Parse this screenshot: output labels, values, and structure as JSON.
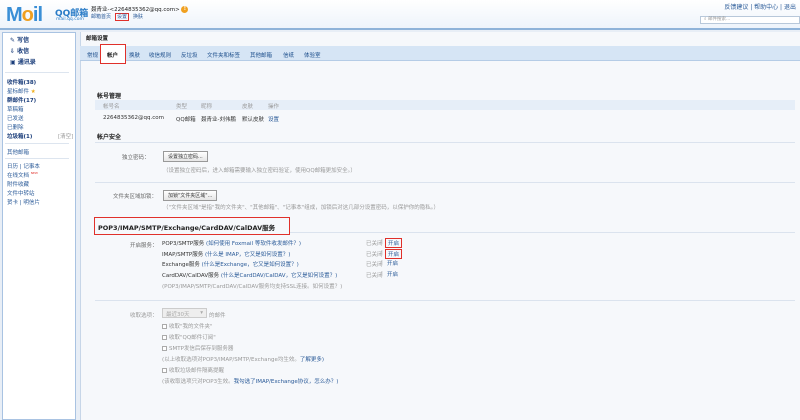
{
  "header": {
    "logo_text": "Mail",
    "brand": "QQ邮箱",
    "domain": "mail.qq.com",
    "user": "聂青业-<2264835362@qq.com>",
    "links": [
      "邮箱首页",
      "设置",
      "换肤"
    ],
    "right_links": "反馈建议 | 帮助中心 | 退出",
    "search_placeholder": "邮件搜索..."
  },
  "sidebar": {
    "write": "写信",
    "inbox": "收信",
    "contacts": "通讯录",
    "folders": [
      "收件箱(38)",
      "星标邮件",
      "群邮件(17)",
      "草稿箱",
      "已发送",
      "已删除",
      "垃圾箱(1)"
    ],
    "clear": "[清空]",
    "other": "其他邮箱",
    "tools": [
      "日历 | 记事本",
      "在线文档",
      "附件收藏",
      "文件中转站",
      "贺卡 | 明信片"
    ],
    "new_badge": "NEW"
  },
  "main": {
    "title": "邮箱设置",
    "tabs": [
      "常规",
      "帐户",
      "换肤",
      "收信规则",
      "反垃圾",
      "文件夹和标签",
      "其他邮箱",
      "信纸",
      "体验室"
    ],
    "acct_mgmt": {
      "title": "帐号管理",
      "headers": [
        "帐号名",
        "类型",
        "昵称",
        "皮肤",
        "操作"
      ],
      "row": [
        "2264835362@qq.com",
        "QQ邮箱",
        "聂青业-刘伟鹏",
        "默认皮肤",
        "设置"
      ]
    },
    "security": {
      "title": "帐户安全",
      "pwd_label": "独立密码：",
      "pwd_btn": "设置独立密码...",
      "pwd_desc": "（设置独立密码后，进入邮箱需要输入独立密码验证，使用QQ邮箱更加安全。）",
      "lock_label": "文件夹区域加锁：",
      "lock_btn": "加锁\"文件夹区域\"...",
      "lock_desc": "（\"文件夹区域\"是指\"我的文件夹\"、\"其他邮箱\"、\"记事本\"组成，加锁后对这几部分设置密码，以保护你的隐私。）"
    },
    "pop": {
      "title": "POP3/IMAP/SMTP/Exchange/CardDAV/CalDAV服务",
      "label": "开启服务：",
      "services": [
        {
          "name": "POP3/SMTP服务",
          "help": "(如何使用 Foxmail 等软件收发邮件？)",
          "status": "已关闭",
          "action": "开启"
        },
        {
          "name": "IMAP/SMTP服务",
          "help": "(什么是 IMAP，它又是如何设置？)",
          "status": "已关闭",
          "action": "开启"
        },
        {
          "name": "Exchange服务",
          "help": "(什么是Exchange，它又是如何设置？)",
          "status": "已关闭",
          "action": "开启"
        },
        {
          "name": "CardDAV/CalDAV服务",
          "help": "(什么是CardDAV/CalDAV，它又是如何设置？)",
          "status": "已关闭",
          "action": "开启"
        }
      ],
      "note": "(POP3/IMAP/SMTP/CardDAV/CalDAV服务均支持SSL连接。如何设置？)"
    },
    "recv": {
      "label": "收取选项：",
      "select": "最近30天",
      "suffix": "的邮件",
      "checks": [
        "收取\"我的文件夹\"",
        "收取\"QQ邮件订阅\"",
        "SMTP发信后保存到服务器"
      ],
      "note1": "(以上收取选项对POP3/IMAP/SMTP/Exchange均生效。",
      "more": "了解更多)",
      "check4": "收取垃圾邮件隔离提醒",
      "note2": "(该收取选项只对POP3生效。",
      "note2link": "我勾选了IMAP/Exchange协议，怎么办？)"
    }
  }
}
